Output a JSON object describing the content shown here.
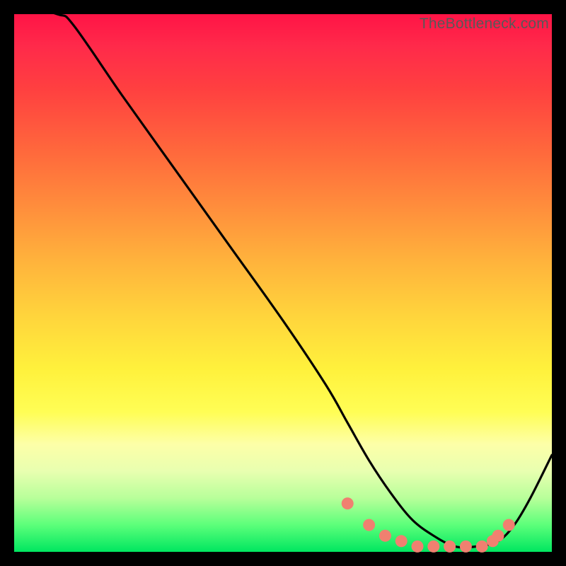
{
  "watermark": "TheBottleneck.com",
  "colors": {
    "background": "#000000",
    "curve": "#000000",
    "marker_fill": "#f08070",
    "marker_stroke": "#d86a5c"
  },
  "chart_data": {
    "type": "line",
    "title": "",
    "xlabel": "",
    "ylabel": "",
    "xlim": [
      0,
      100
    ],
    "ylim": [
      0,
      100
    ],
    "series": [
      {
        "name": "bottleneck-curve",
        "x": [
          0,
          8,
          11,
          20,
          30,
          40,
          50,
          58,
          62,
          66,
          70,
          74,
          78,
          82,
          86,
          90,
          93,
          96,
          100
        ],
        "y": [
          102,
          100,
          98,
          85,
          71,
          57,
          43,
          31,
          24,
          17,
          11,
          6,
          3,
          1,
          1,
          2,
          5,
          10,
          18
        ]
      }
    ],
    "markers": {
      "name": "near-zero-markers",
      "x": [
        62,
        66,
        69,
        72,
        75,
        78,
        81,
        84,
        87,
        89,
        90,
        92
      ],
      "y": [
        9,
        5,
        3,
        2,
        1,
        1,
        1,
        1,
        1,
        2,
        3,
        5
      ]
    }
  }
}
